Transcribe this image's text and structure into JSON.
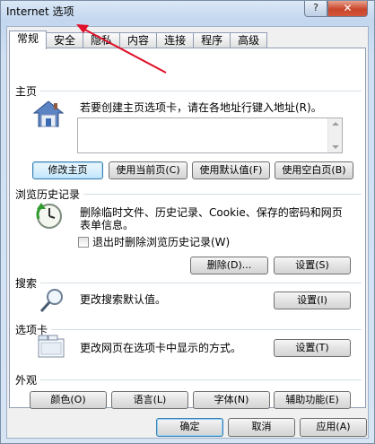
{
  "window": {
    "title": "Internet 选项",
    "help_glyph": "?",
    "close_glyph": "✕"
  },
  "tabs": [
    {
      "label": "常规",
      "active": true
    },
    {
      "label": "安全"
    },
    {
      "label": "隐私"
    },
    {
      "label": "内容"
    },
    {
      "label": "连接"
    },
    {
      "label": "程序"
    },
    {
      "label": "高级"
    }
  ],
  "homepage": {
    "heading": "主页",
    "description": "若要创建主页选项卡，请在各地址行键入地址(R)。",
    "address_value": "",
    "buttons": [
      "修改主页",
      "使用当前页(C)",
      "使用默认值(F)",
      "使用空白页(B)"
    ]
  },
  "history": {
    "heading": "浏览历史记录",
    "description_line1": "删除临时文件、历史记录、Cookie、保存的密码和网页",
    "description_line2": "表单信息。",
    "checkbox_label": "退出时删除浏览历史记录(W)",
    "checkbox_checked": false,
    "delete_button": "删除(D)...",
    "settings_button": "设置(S)"
  },
  "search": {
    "heading": "搜索",
    "description": "更改搜索默认值。",
    "settings_button": "设置(I)"
  },
  "tabsgroup": {
    "heading": "选项卡",
    "description": "更改网页在选项卡中显示的方式。",
    "settings_button": "设置(T)"
  },
  "appearance": {
    "heading": "外观",
    "buttons": [
      "颜色(O)",
      "语言(L)",
      "字体(N)",
      "辅助功能(E)"
    ]
  },
  "footer": {
    "ok": "确定",
    "cancel": "取消",
    "apply": "应用(A)"
  },
  "colors": {
    "annotation_arrow": "#e0102a",
    "focus_border": "#3c7fb1"
  }
}
